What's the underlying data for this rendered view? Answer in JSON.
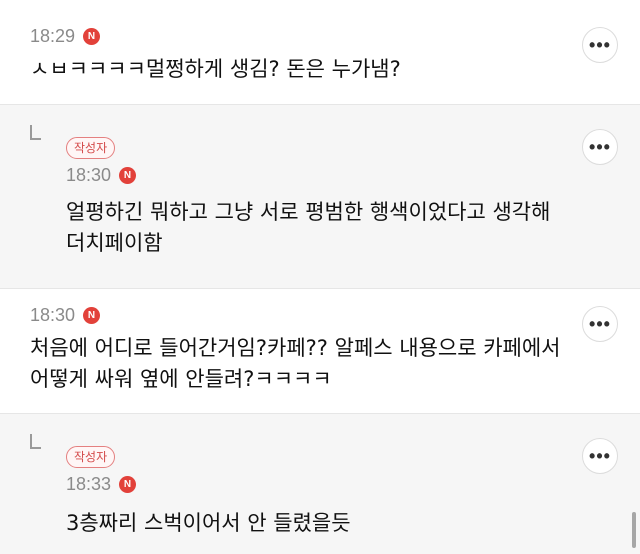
{
  "comments": [
    {
      "time": "18:29",
      "badge": "N",
      "text": "ㅅㅂㅋㅋㅋㅋ멀쩡하게 생김? 돈은 누가냄?",
      "more_label": "•••"
    },
    {
      "reply_badge": "작성자",
      "time": "18:30",
      "badge": "N",
      "text": "얼평하긴 뭐하고 그냥 서로 평범한 행색이었다고 생각해\n더치페이함",
      "more_label": "•••"
    },
    {
      "time": "18:30",
      "badge": "N",
      "text": "처음에 어디로 들어간거임?카페?? 알페스 내용으로 카페에서\n어떻게 싸워 옆에 안들려?ㅋㅋㅋㅋ",
      "more_label": "•••"
    },
    {
      "reply_badge": "작성자",
      "time": "18:33",
      "badge": "N",
      "text": "3층짜리 스벅이어서 안 들렸을듯",
      "more_label": "•••"
    }
  ]
}
